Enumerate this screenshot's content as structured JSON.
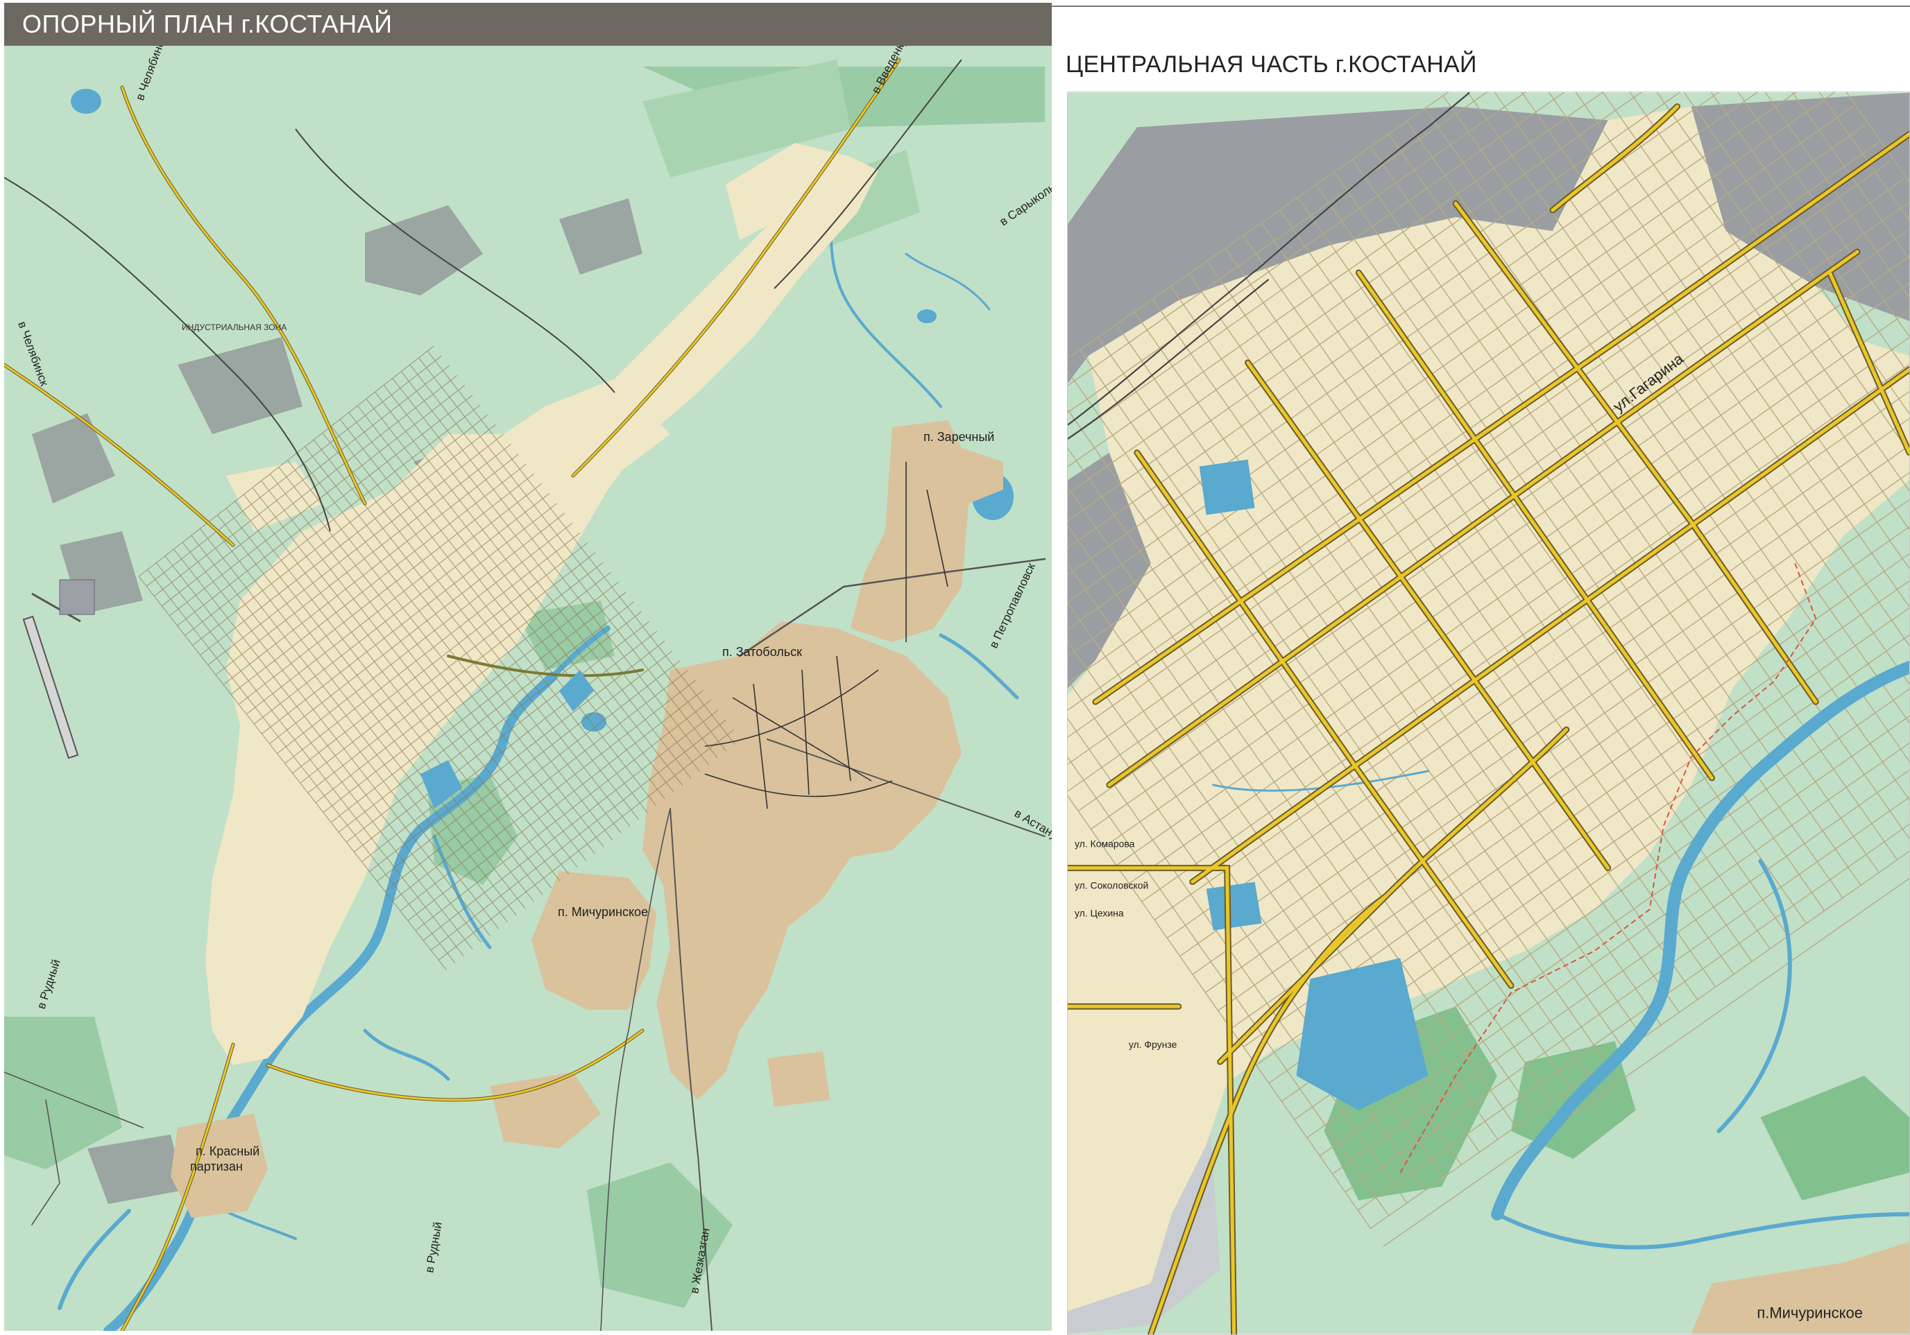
{
  "left": {
    "title": "ОПОРНЫЙ ПЛАН г.КОСТАНАЙ",
    "labels": {
      "zarechny": "п. Заречный",
      "zatobolsk": "п. Затобольск",
      "michurinskoe": "п. Мичуринское",
      "krasny": "п. Красный",
      "partizan": "партизан",
      "industrial": "ИНДУСТРИАЛЬНАЯ ЗОНА"
    },
    "directions": {
      "chelyabinsk_top": "в Челябинск",
      "chelyabinsk_left": "в Челябинск",
      "vvedenku": "в Введенку",
      "sarykol": "в Сарыколь",
      "petropavlovsk": "в Петропавловск",
      "astana": "в Астану",
      "rudny_left": "в Рудный",
      "rudny_bottom": "в Рудный",
      "zhezkazgan": "в Жезказган"
    }
  },
  "right": {
    "title": "ЦЕНТРАЛЬНАЯ ЧАСТЬ г.КОСТАНАЙ",
    "labels": {
      "gagarina": "ул.Гагарина",
      "michurinskoe": "п.Мичуринское",
      "frunze": "ул. Фрунзе",
      "komarova": "ул. Комарова",
      "sokolovskaya": "ул. Соколовской",
      "tsekhina": "ул. Цехина"
    }
  },
  "colors": {
    "green_bg": "#c1e0c8",
    "city_fill": "#f0e7c6",
    "settlement_fill": "#d9c29c",
    "water": "#5aa9cf",
    "road_major": "#e9c728",
    "road_outline": "#6b5a2a",
    "industrial": "#8d9196",
    "title_bar": "#6d6862"
  }
}
